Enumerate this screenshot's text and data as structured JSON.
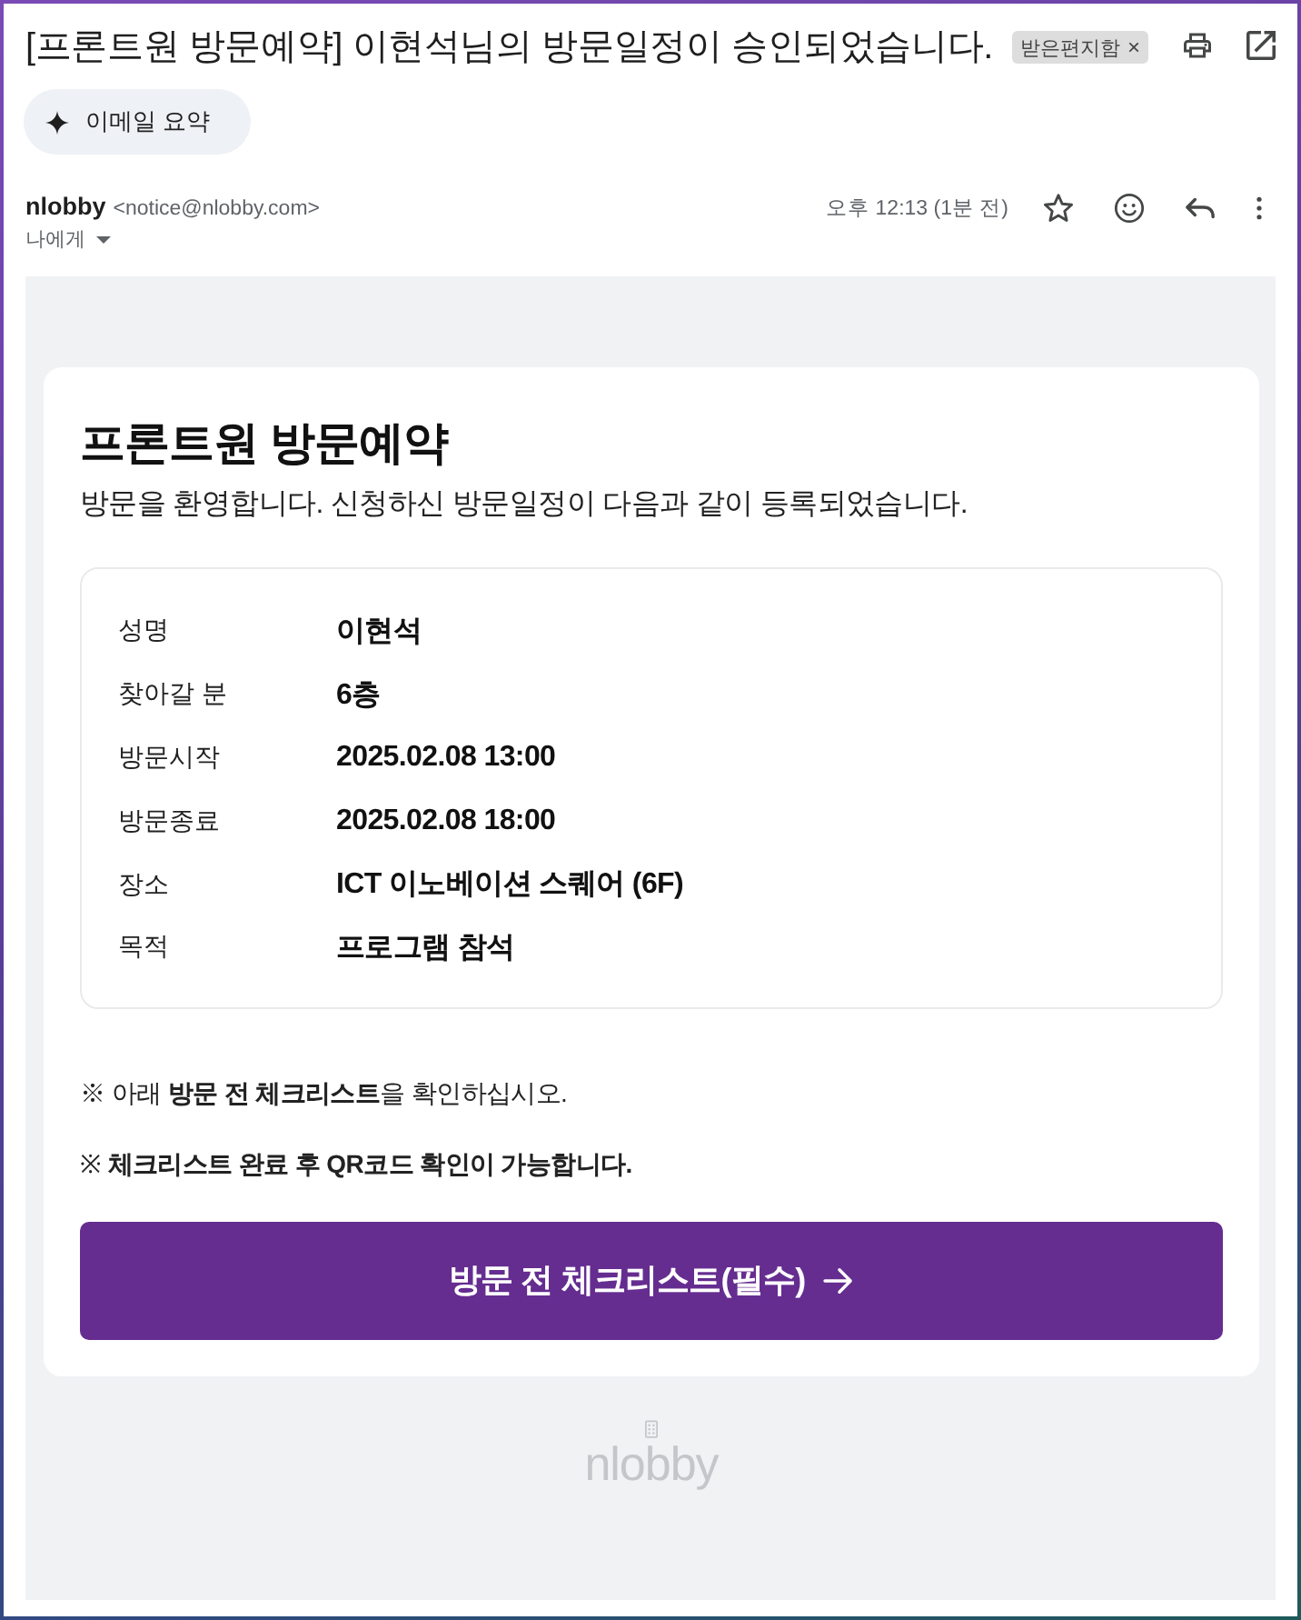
{
  "email": {
    "subject": "[프론트원 방문예약] 이현석님의 방문일정이 승인되었습니다.",
    "labels": [
      {
        "name": "받은편지함",
        "remove": "×"
      }
    ]
  },
  "summary_button": {
    "label": "이메일 요약"
  },
  "sender": {
    "name": "nlobby",
    "address": "<notice@nlobby.com>",
    "recipient": "나에게",
    "time": "오후 12:13 (1분 전)",
    "starred": false
  },
  "body": {
    "heading": "프론트원 방문예약",
    "intro": "방문을 환영합니다. 신청하신 방문일정이 다음과 같이 등록되었습니다.",
    "details": [
      {
        "label": "성명",
        "value": "이현석"
      },
      {
        "label": "찾아갈 분",
        "value": "6층"
      },
      {
        "label": "방문시작",
        "value": "2025.02.08 13:00"
      },
      {
        "label": "방문종료",
        "value": "2025.02.08 18:00"
      },
      {
        "label": "장소",
        "value": "ICT 이노베이션 스퀘어 (6F)"
      },
      {
        "label": "목적",
        "value": "프로그램 참석"
      }
    ],
    "notes": [
      "※ 아래 **방문 전 체크리스트**을 확인하십시오.",
      "※ **체크리스트 완료 후 QR코드 확인이 가능합니다.**"
    ],
    "cta": {
      "label": "방문 전 체크리스트(필수)"
    },
    "footer": {
      "logo": "nlobby"
    }
  }
}
